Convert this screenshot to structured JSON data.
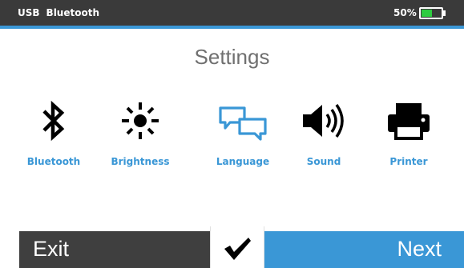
{
  "status_bar": {
    "usb_label": "USB",
    "bluetooth_label": "Bluetooth",
    "battery_percent": "50%",
    "battery_level": 0.5,
    "background_color": "#3a3a3a",
    "accent_color": "#3a97d6",
    "battery_color": "#2ecc40"
  },
  "page_title": "Settings",
  "settings_items": [
    {
      "label": "Bluetooth",
      "icon": "bluetooth-icon"
    },
    {
      "label": "Brightness",
      "icon": "brightness-icon"
    },
    {
      "label": "Language",
      "icon": "language-icon"
    },
    {
      "label": "Sound",
      "icon": "sound-icon"
    },
    {
      "label": "Printer",
      "icon": "printer-icon"
    }
  ],
  "bottom_bar": {
    "exit_label": "Exit",
    "confirm_icon": "checkmark-icon",
    "next_label": "Next",
    "exit_color": "#3f3f3f",
    "next_color": "#3a97d6"
  },
  "label_color": "#3a97d6"
}
